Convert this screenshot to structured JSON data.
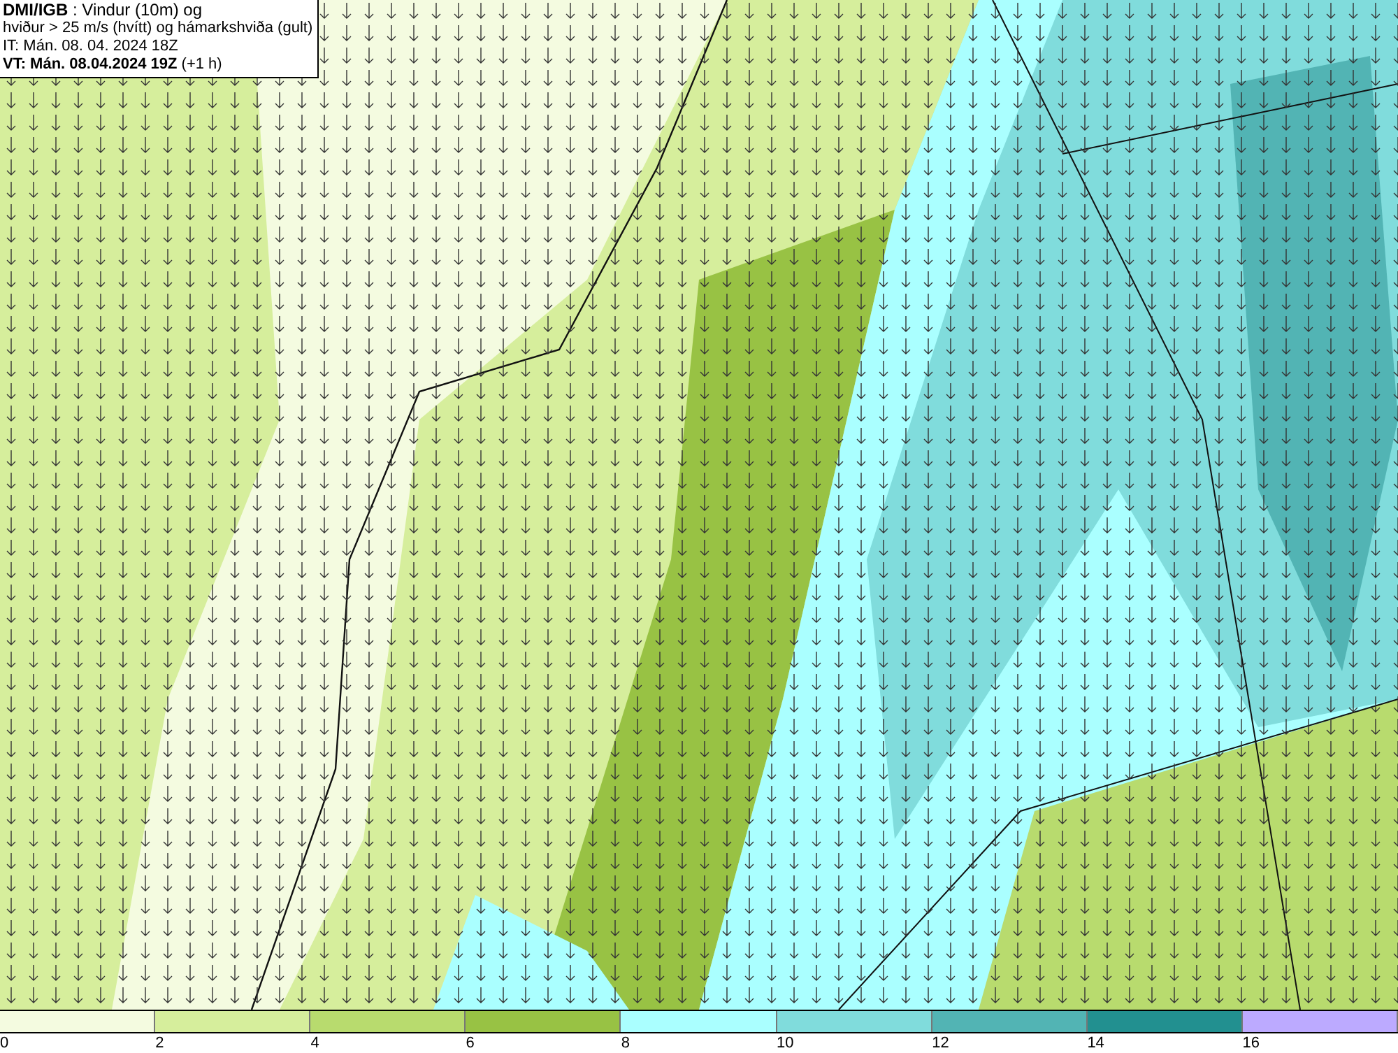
{
  "title_box": {
    "lines": [
      "**DMI/IGB** : Vindur (10m) og",
      "hviður > 25 m/s (hvítt) og hámarkshviða (gult)",
      "IT: Mán. 08. 04. 2024 18Z",
      "**VT: Mán. 08.04.2024 19Z** (+1 h)"
    ]
  },
  "legend": {
    "bins": [
      {
        "color": "#f4fbe0"
      },
      {
        "color": "#d6ee9c"
      },
      {
        "color": "#b8db6e"
      },
      {
        "color": "#98c244"
      },
      {
        "color": "#aaffff"
      },
      {
        "color": "#80dcdc"
      },
      {
        "color": "#52b4b4"
      },
      {
        "color": "#229090"
      },
      {
        "color": "#bcaaff"
      }
    ],
    "labels": [
      "0",
      "2",
      "4",
      "6",
      "8",
      "10",
      "12",
      "14",
      "16"
    ]
  }
}
